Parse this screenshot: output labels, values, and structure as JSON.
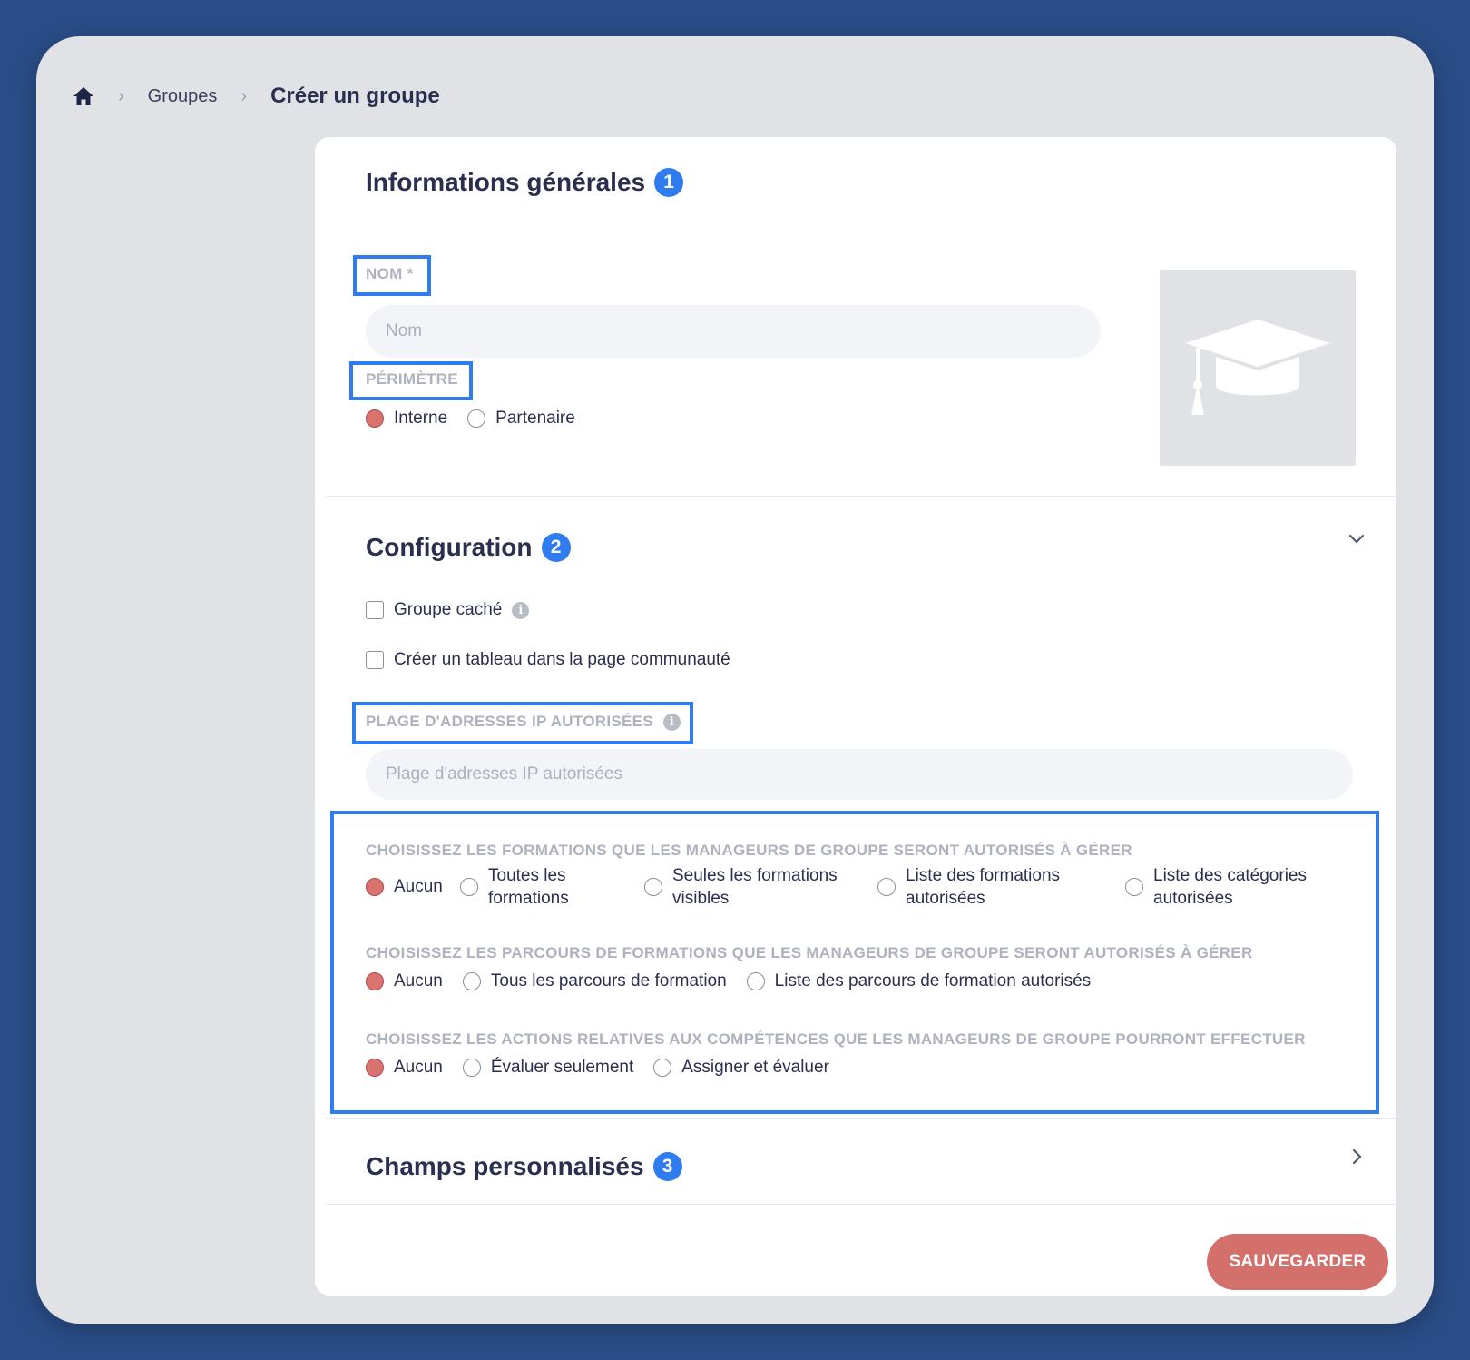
{
  "breadcrumb": {
    "home_icon": "home-icon",
    "items": [
      "Groupes"
    ],
    "current": "Créer un groupe"
  },
  "general": {
    "title": "Informations générales",
    "step": "1",
    "name_label": "NOM *",
    "name_placeholder": "Nom",
    "name_value": "",
    "scope_label": "PÉRIMÈTRE",
    "scope_options": [
      "Interne",
      "Partenaire"
    ],
    "scope_selected": "Interne",
    "image_icon": "graduation-cap-icon"
  },
  "configuration": {
    "title": "Configuration",
    "step": "2",
    "hidden_group_label": "Groupe caché",
    "community_board_label": "Créer un tableau dans la page communauté",
    "ip_label": "PLAGE D'ADRESSES IP AUTORISÉES",
    "ip_placeholder": "Plage d'adresses IP autorisées",
    "trainings": {
      "label": "CHOISISSEZ LES FORMATIONS QUE LES MANAGEURS DE GROUPE SERONT AUTORISÉS À GÉRER",
      "options": [
        "Aucun",
        "Toutes les formations",
        "Seules les formations visibles",
        "Liste des formations autorisées",
        "Liste des catégories autorisées"
      ],
      "selected": "Aucun"
    },
    "paths": {
      "label": "CHOISISSEZ LES PARCOURS DE FORMATIONS QUE LES MANAGEURS DE GROUPE SERONT AUTORISÉS À GÉRER",
      "options": [
        "Aucun",
        "Tous les parcours de formation",
        "Liste des parcours de formation autorisés"
      ],
      "selected": "Aucun"
    },
    "skills": {
      "label": "CHOISISSEZ LES ACTIONS RELATIVES AUX COMPÉTENCES QUE LES MANAGEURS DE GROUPE POURRONT EFFECTUER",
      "options": [
        "Aucun",
        "Évaluer seulement",
        "Assigner et évaluer"
      ],
      "selected": "Aucun"
    }
  },
  "custom_fields": {
    "title": "Champs personnalisés",
    "step": "3"
  },
  "save_label": "SAUVEGARDER",
  "colors": {
    "background": "#2a4d87",
    "accent": "#2f7bf0",
    "primary_button": "#d3706c",
    "radio_checked": "#d9736f"
  }
}
